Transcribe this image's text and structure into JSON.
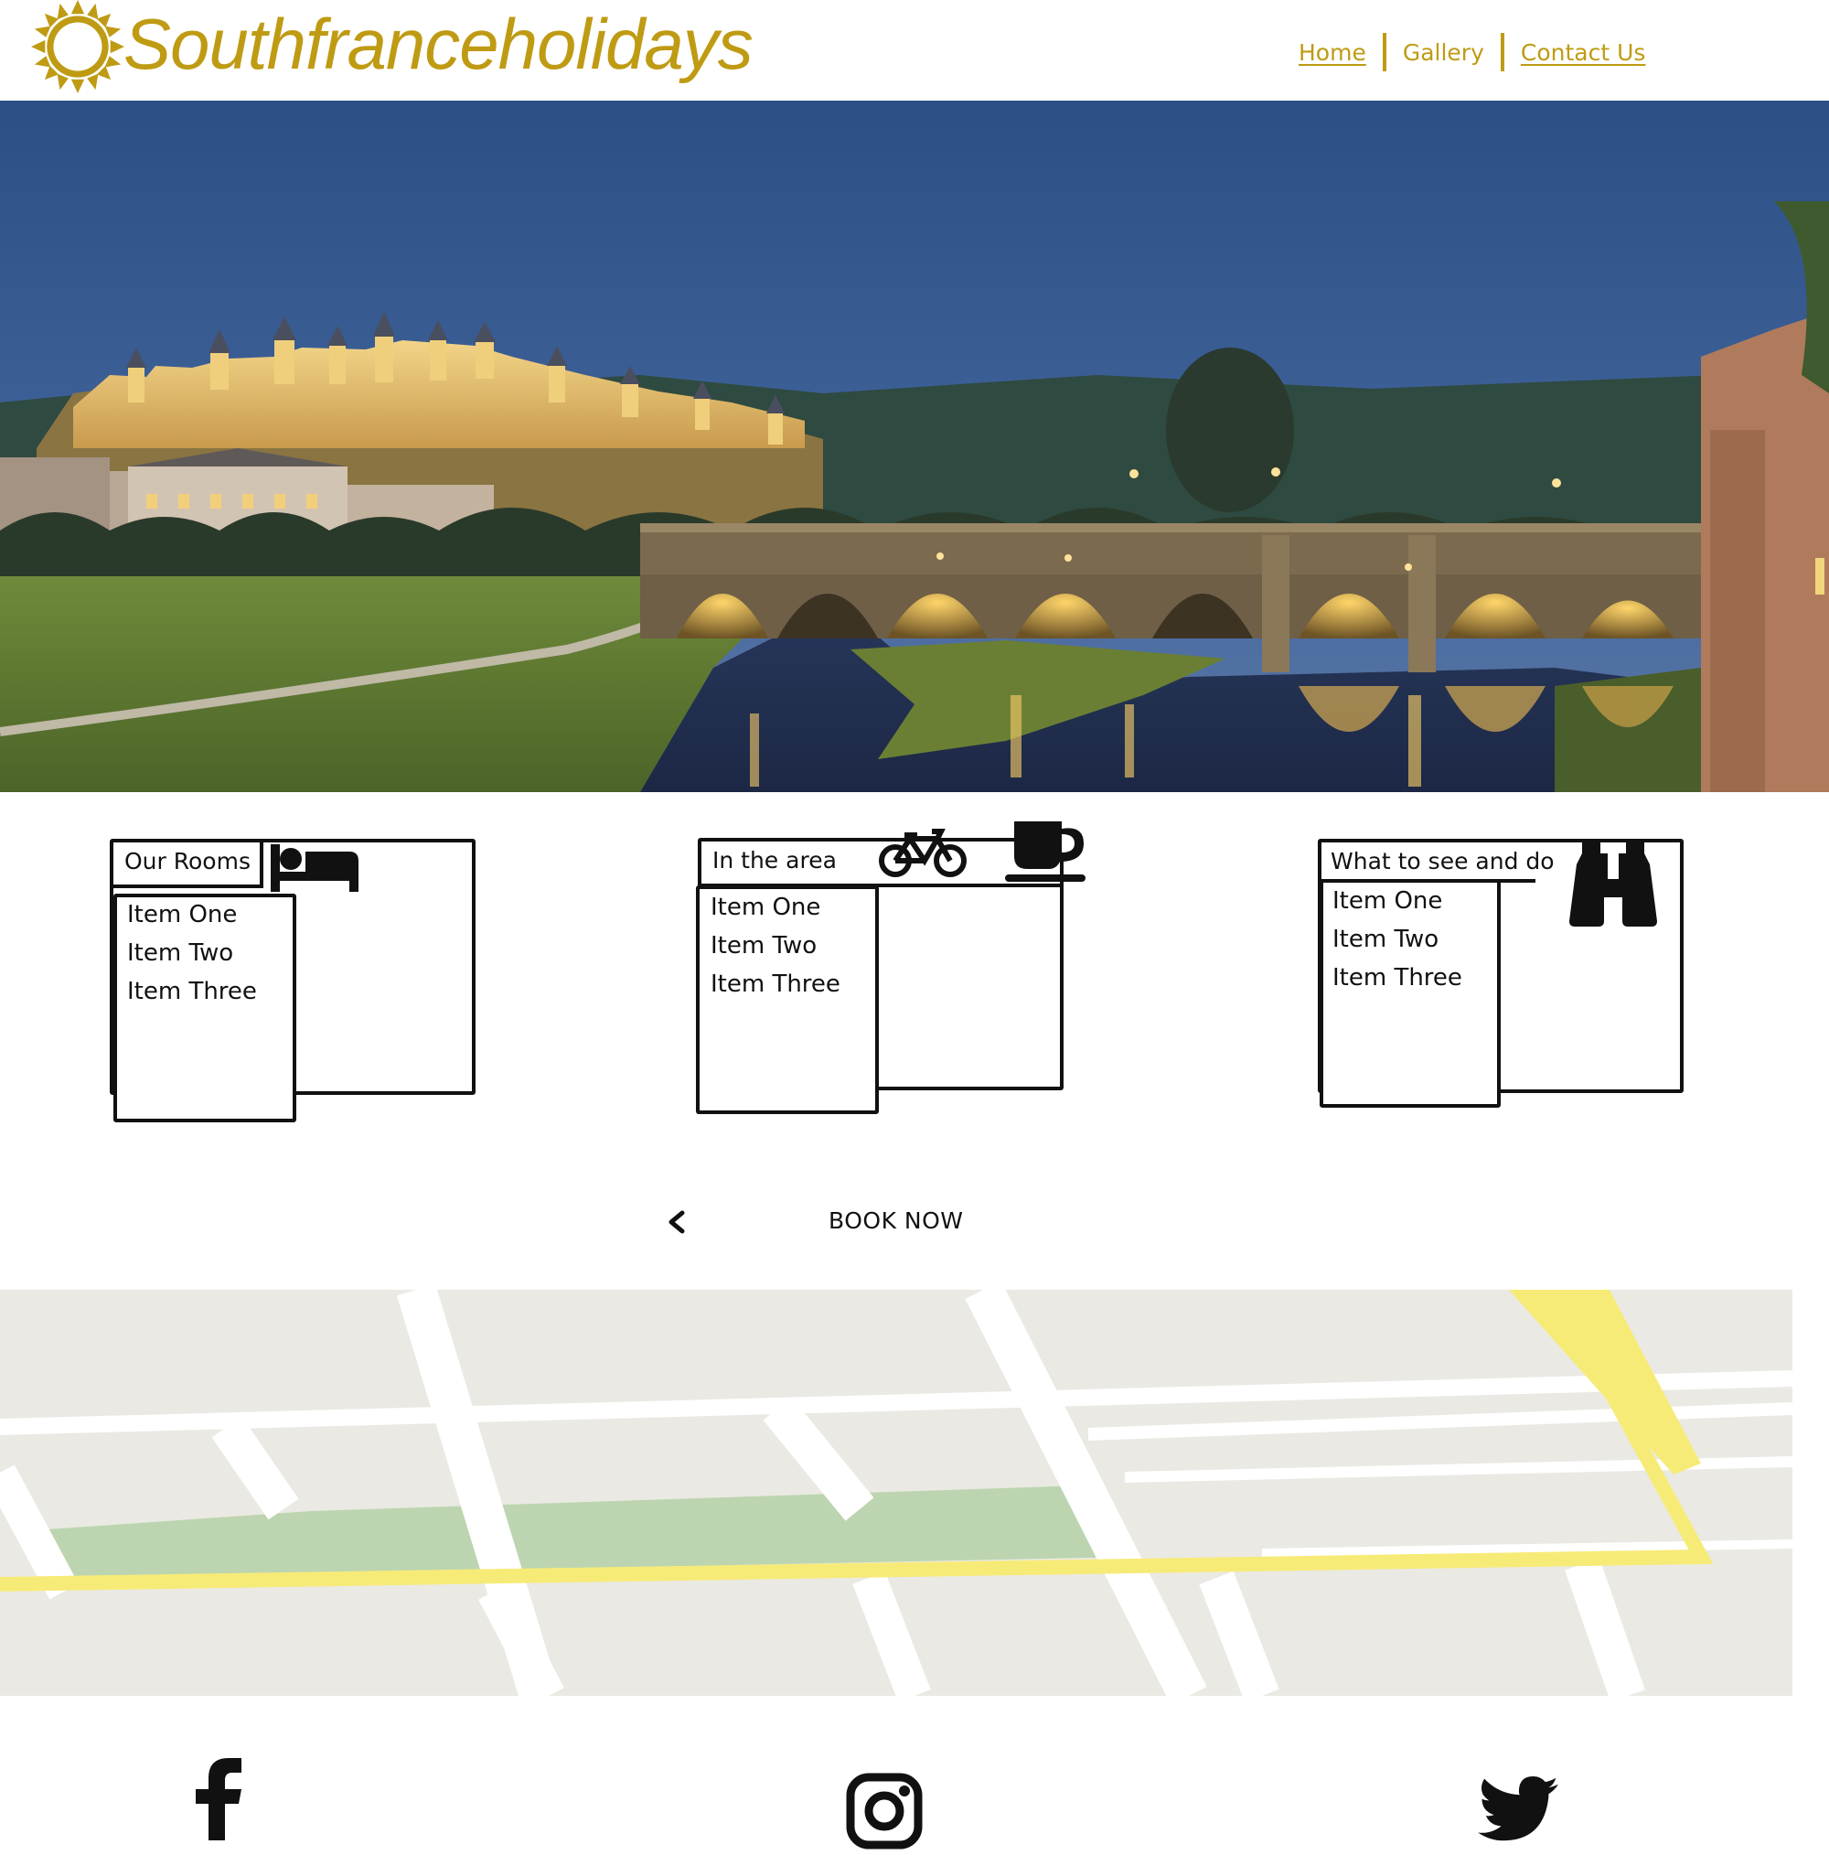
{
  "brand": {
    "name": "Southfranceholidays",
    "color": "#bf9b14",
    "logo_icon": "sun-icon"
  },
  "nav": {
    "items": [
      {
        "label": "Home",
        "active": true
      },
      {
        "label": "Gallery",
        "active": false
      },
      {
        "label": "Contact Us",
        "active": false
      }
    ]
  },
  "hero": {
    "image": "carcassonne-citadel-bridge-night"
  },
  "cards": [
    {
      "title": "Our Rooms",
      "icons": [
        "bed-icon"
      ],
      "items": [
        "Item One",
        "Item Two",
        "Item Three"
      ]
    },
    {
      "title": "In the area",
      "icons": [
        "bicycle-icon",
        "coffee-cup-icon"
      ],
      "items": [
        "Item One",
        "Item Two",
        "Item Three"
      ]
    },
    {
      "title": "What to see and do",
      "icons": [
        "binoculars-icon"
      ],
      "items": [
        "Item One",
        "Item Two",
        "Item Three"
      ]
    }
  ],
  "booking": {
    "prev_icon": "chevron-left-icon",
    "label": "BOOK NOW"
  },
  "map": {
    "land_color": "#ebe9e3",
    "road_color": "#ffffff",
    "highway_color": "#f7eb78",
    "park_color": "#bcd5b0"
  },
  "social": [
    {
      "icon": "facebook-icon"
    },
    {
      "icon": "instagram-icon"
    },
    {
      "icon": "twitter-icon"
    }
  ]
}
